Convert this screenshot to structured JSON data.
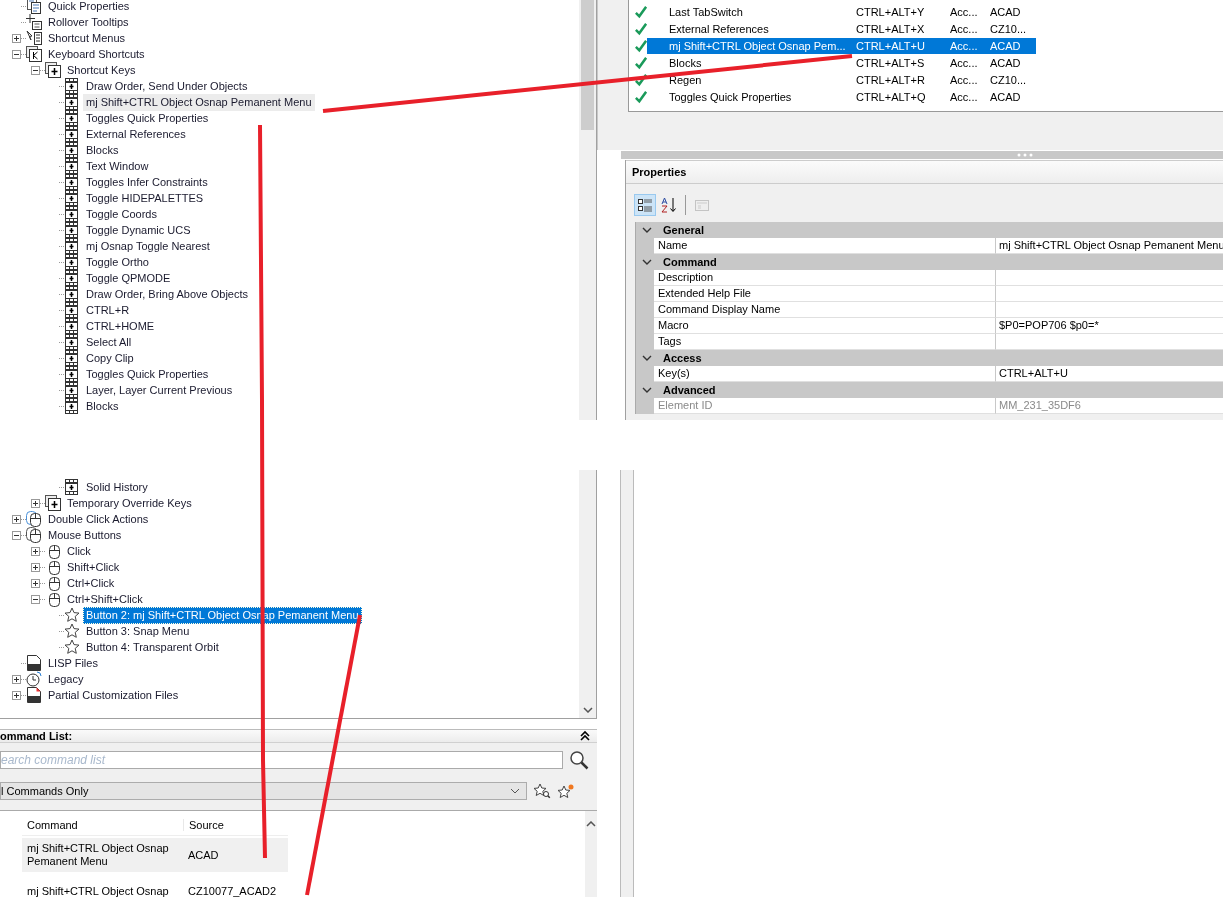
{
  "tree_top": [
    {
      "label": "Quick Properties",
      "kind": "properties",
      "selected": false,
      "highlighted": false
    },
    {
      "label": "Rollover Tooltips",
      "kind": "tooltip",
      "selected": false,
      "highlighted": false
    },
    {
      "label": "Shortcut Menus",
      "kind": "menu",
      "expanded": false,
      "selected": false,
      "highlighted": false
    },
    {
      "label": "Keyboard Shortcuts",
      "kind": "keyboard",
      "expanded": true,
      "selected": false,
      "highlighted": false,
      "children": [
        {
          "label": "Shortcut Keys",
          "kind": "keys",
          "expanded": true,
          "selected": false,
          "highlighted": false,
          "children": [
            {
              "label": "Draw Order, Send Under Objects",
              "kind": "key",
              "selected": false,
              "highlighted": false
            },
            {
              "label": "mj Shift+CTRL Object Osnap Pemanent Menu",
              "kind": "key",
              "selected": false,
              "highlighted": true
            },
            {
              "label": "Toggles Quick Properties",
              "kind": "key",
              "selected": false,
              "highlighted": false
            },
            {
              "label": "External References",
              "kind": "key",
              "selected": false,
              "highlighted": false
            },
            {
              "label": "Blocks",
              "kind": "key",
              "selected": false,
              "highlighted": false
            },
            {
              "label": "Text Window",
              "kind": "key",
              "selected": false,
              "highlighted": false
            },
            {
              "label": "Toggles Infer Constraints",
              "kind": "key",
              "selected": false,
              "highlighted": false
            },
            {
              "label": "Toggle HIDEPALETTES",
              "kind": "key",
              "selected": false,
              "highlighted": false
            },
            {
              "label": "Toggle Coords",
              "kind": "key",
              "selected": false,
              "highlighted": false
            },
            {
              "label": "Toggle Dynamic UCS",
              "kind": "key",
              "selected": false,
              "highlighted": false
            },
            {
              "label": "mj Osnap Toggle Nearest",
              "kind": "key",
              "selected": false,
              "highlighted": false
            },
            {
              "label": "Toggle Ortho",
              "kind": "key",
              "selected": false,
              "highlighted": false
            },
            {
              "label": "Toggle QPMODE",
              "kind": "key",
              "selected": false,
              "highlighted": false
            },
            {
              "label": "Draw Order, Bring Above Objects",
              "kind": "key",
              "selected": false,
              "highlighted": false
            },
            {
              "label": "CTRL+R",
              "kind": "key",
              "selected": false,
              "highlighted": false
            },
            {
              "label": "CTRL+HOME",
              "kind": "key",
              "selected": false,
              "highlighted": false
            },
            {
              "label": "Select All",
              "kind": "key",
              "selected": false,
              "highlighted": false
            },
            {
              "label": "Copy Clip",
              "kind": "key",
              "selected": false,
              "highlighted": false
            },
            {
              "label": "Toggles Quick Properties",
              "kind": "key",
              "selected": false,
              "highlighted": false
            },
            {
              "label": "Layer, Layer Current Previous",
              "kind": "key",
              "selected": false,
              "highlighted": false
            },
            {
              "label": "Blocks",
              "kind": "key",
              "selected": false,
              "highlighted": false
            }
          ]
        }
      ]
    }
  ],
  "tree_bottom": [
    {
      "children": [
        {
          "children": [
            {
              "label": "Solid History",
              "kind": "key",
              "selected": false,
              "highlighted": false
            }
          ]
        },
        {
          "label": "Temporary Override Keys",
          "kind": "keys",
          "expanded": false,
          "selected": false,
          "highlighted": false
        }
      ]
    },
    {
      "label": "Double Click Actions",
      "kind": "double-click",
      "expanded": false,
      "selected": false,
      "highlighted": false
    },
    {
      "label": "Mouse Buttons",
      "kind": "mouse-group",
      "expanded": true,
      "selected": false,
      "highlighted": false,
      "children": [
        {
          "label": "Click",
          "kind": "mouse",
          "expanded": false,
          "selected": false,
          "highlighted": false
        },
        {
          "label": "Shift+Click",
          "kind": "mouse",
          "expanded": false,
          "selected": false,
          "highlighted": false
        },
        {
          "label": "Ctrl+Click",
          "kind": "mouse",
          "expanded": false,
          "selected": false,
          "highlighted": false
        },
        {
          "label": "Ctrl+Shift+Click",
          "kind": "mouse",
          "expanded": true,
          "selected": false,
          "highlighted": false,
          "children": [
            {
              "label": "Button 2: mj Shift+CTRL Object Osnap Pemanent Menu",
              "kind": "star",
              "selected": true,
              "highlighted": false
            },
            {
              "label": "Button 3: Snap Menu",
              "kind": "star",
              "selected": false,
              "highlighted": false
            },
            {
              "label": "Button 4: Transparent Orbit",
              "kind": "star",
              "selected": false,
              "highlighted": false
            }
          ]
        }
      ]
    },
    {
      "label": "LISP Files",
      "kind": "lisp",
      "selected": false,
      "highlighted": false
    },
    {
      "label": "Legacy",
      "kind": "legacy",
      "expanded": false,
      "selected": false,
      "highlighted": false
    },
    {
      "label": "Partial Customization Files",
      "kind": "partial",
      "expanded": false,
      "selected": false,
      "highlighted": false
    }
  ],
  "shortcut_list": {
    "rows": [
      {
        "checked": true,
        "name": "Last TabSwitch",
        "keys": "CTRL+ALT+Y",
        "type": "Acc...",
        "source": "ACAD",
        "selected": false
      },
      {
        "checked": true,
        "name": "External References",
        "keys": "CTRL+ALT+X",
        "type": "Acc...",
        "source": "CZ10...",
        "selected": false
      },
      {
        "checked": true,
        "name": "mj Shift+CTRL Object Osnap Pem...",
        "keys": "CTRL+ALT+U",
        "type": "Acc...",
        "source": "ACAD",
        "selected": true
      },
      {
        "checked": true,
        "name": "Blocks",
        "keys": "CTRL+ALT+S",
        "type": "Acc...",
        "source": "ACAD",
        "selected": false
      },
      {
        "checked": true,
        "name": "Regen",
        "keys": "CTRL+ALT+R",
        "type": "Acc...",
        "source": "CZ10...",
        "selected": false
      },
      {
        "checked": true,
        "name": "Toggles Quick Properties",
        "keys": "CTRL+ALT+Q",
        "type": "Acc...",
        "source": "ACAD",
        "selected": false
      }
    ]
  },
  "properties": {
    "title": "Properties",
    "toolbar": [
      {
        "kind": "categorized",
        "selected": true,
        "disabled": false
      },
      {
        "kind": "alphabetical",
        "selected": false,
        "disabled": false
      },
      {
        "kind": "pages",
        "selected": false,
        "disabled": true
      }
    ],
    "sections": [
      {
        "title": "General",
        "expanded": true,
        "rows": [
          {
            "name": "Name",
            "value": "mj Shift+CTRL Object Osnap Pemanent Menu",
            "disabled": false
          }
        ]
      },
      {
        "title": "Command",
        "expanded": true,
        "rows": [
          {
            "name": "Description",
            "disabled": false
          },
          {
            "name": "Extended Help File",
            "disabled": false
          },
          {
            "name": "Command Display Name",
            "disabled": false
          },
          {
            "name": "Macro",
            "value": "$P0=POP706 $p0=*",
            "disabled": false
          },
          {
            "name": "Tags",
            "disabled": false
          }
        ]
      },
      {
        "title": "Access",
        "expanded": true,
        "rows": [
          {
            "name": "Key(s)",
            "value": "CTRL+ALT+U",
            "disabled": false
          }
        ]
      },
      {
        "title": "Advanced",
        "expanded": true,
        "rows": [
          {
            "name": "Element ID",
            "value": "MM_231_35DF6",
            "disabled": true
          }
        ]
      }
    ]
  },
  "command_list": {
    "title": "ommand List:",
    "search": {
      "placeholder": "earch command list"
    },
    "filter": {
      "value": "l Commands Only"
    },
    "columns": [
      "Command",
      "Source"
    ],
    "rows": [
      {
        "command": "mj Shift+CTRL Object Osnap Pemanent Menu",
        "source": "ACAD",
        "selected": true
      },
      {
        "command": "mj Shift+CTRL Object Osnap",
        "source": "CZ10077_ACAD2",
        "selected": false
      }
    ]
  }
}
